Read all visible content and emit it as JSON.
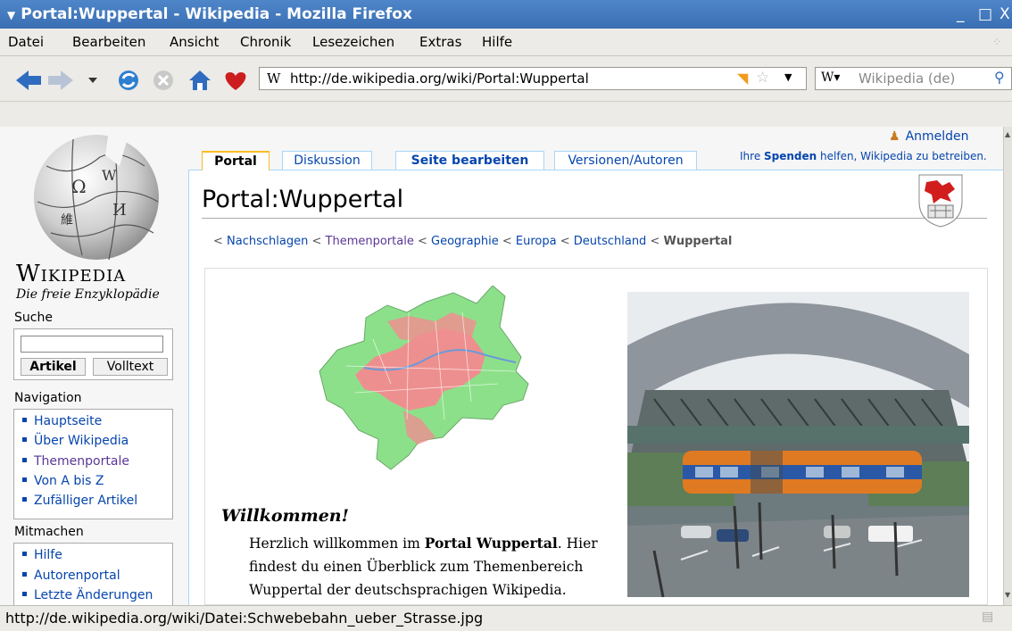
{
  "window": {
    "title": "Portal:Wuppertal - Wikipedia - Mozilla Firefox",
    "controls": [
      "_",
      "□",
      "X"
    ]
  },
  "menu": [
    "Datei",
    "Bearbeiten",
    "Ansicht",
    "Chronik",
    "Lesezeichen",
    "Extras",
    "Hilfe"
  ],
  "toolbar": {
    "url": "http://de.wikipedia.org/wiki/Portal:Wuppertal",
    "search_placeholder": "Wikipedia (de)",
    "site_icon": "W"
  },
  "sidebar": {
    "logo_wordmark": "Wikipedia",
    "logo_tagline": "Die freie Enzyklopädie",
    "search_heading": "Suche",
    "search_btn_article": "Artikel",
    "search_btn_fulltext": "Volltext",
    "nav_heading": "Navigation",
    "nav_items": [
      "Hauptseite",
      "Über Wikipedia",
      "Themenportale",
      "Von A bis Z",
      "Zufälliger Artikel"
    ],
    "participate_heading": "Mitmachen",
    "participate_items": [
      "Hilfe",
      "Autorenportal",
      "Letzte Änderungen"
    ]
  },
  "personal": {
    "login": "Anmelden",
    "donate_prefix": "Ihre ",
    "donate_link": "Spenden",
    "donate_suffix": " helfen, Wikipedia zu betreiben."
  },
  "tabs": [
    "Portal",
    "Diskussion",
    "Seite bearbeiten",
    "Versionen/Autoren"
  ],
  "page": {
    "title": "Portal:Wuppertal",
    "breadcrumb": [
      "Nachschlagen",
      "Themenportale",
      "Geographie",
      "Europa",
      "Deutschland",
      "Wuppertal"
    ],
    "welcome_heading": "Willkommen!",
    "welcome_line1_a": "Herzlich willkommen im ",
    "welcome_line1_b": "Portal Wuppertal",
    "welcome_line1_c": ". Hier",
    "welcome_line2": "findest du einen Überblick zum Themenbereich",
    "welcome_line3": "Wuppertal der deutschsprachigen Wikipedia."
  },
  "status": {
    "text": "http://de.wikipedia.org/wiki/Datei:Schwebebahn_ueber_Strasse.jpg"
  },
  "colors": {
    "link": "#0645ad",
    "visited": "#5a3696",
    "titlebar": "#3a6fb3",
    "chrome": "#ecebe7"
  }
}
